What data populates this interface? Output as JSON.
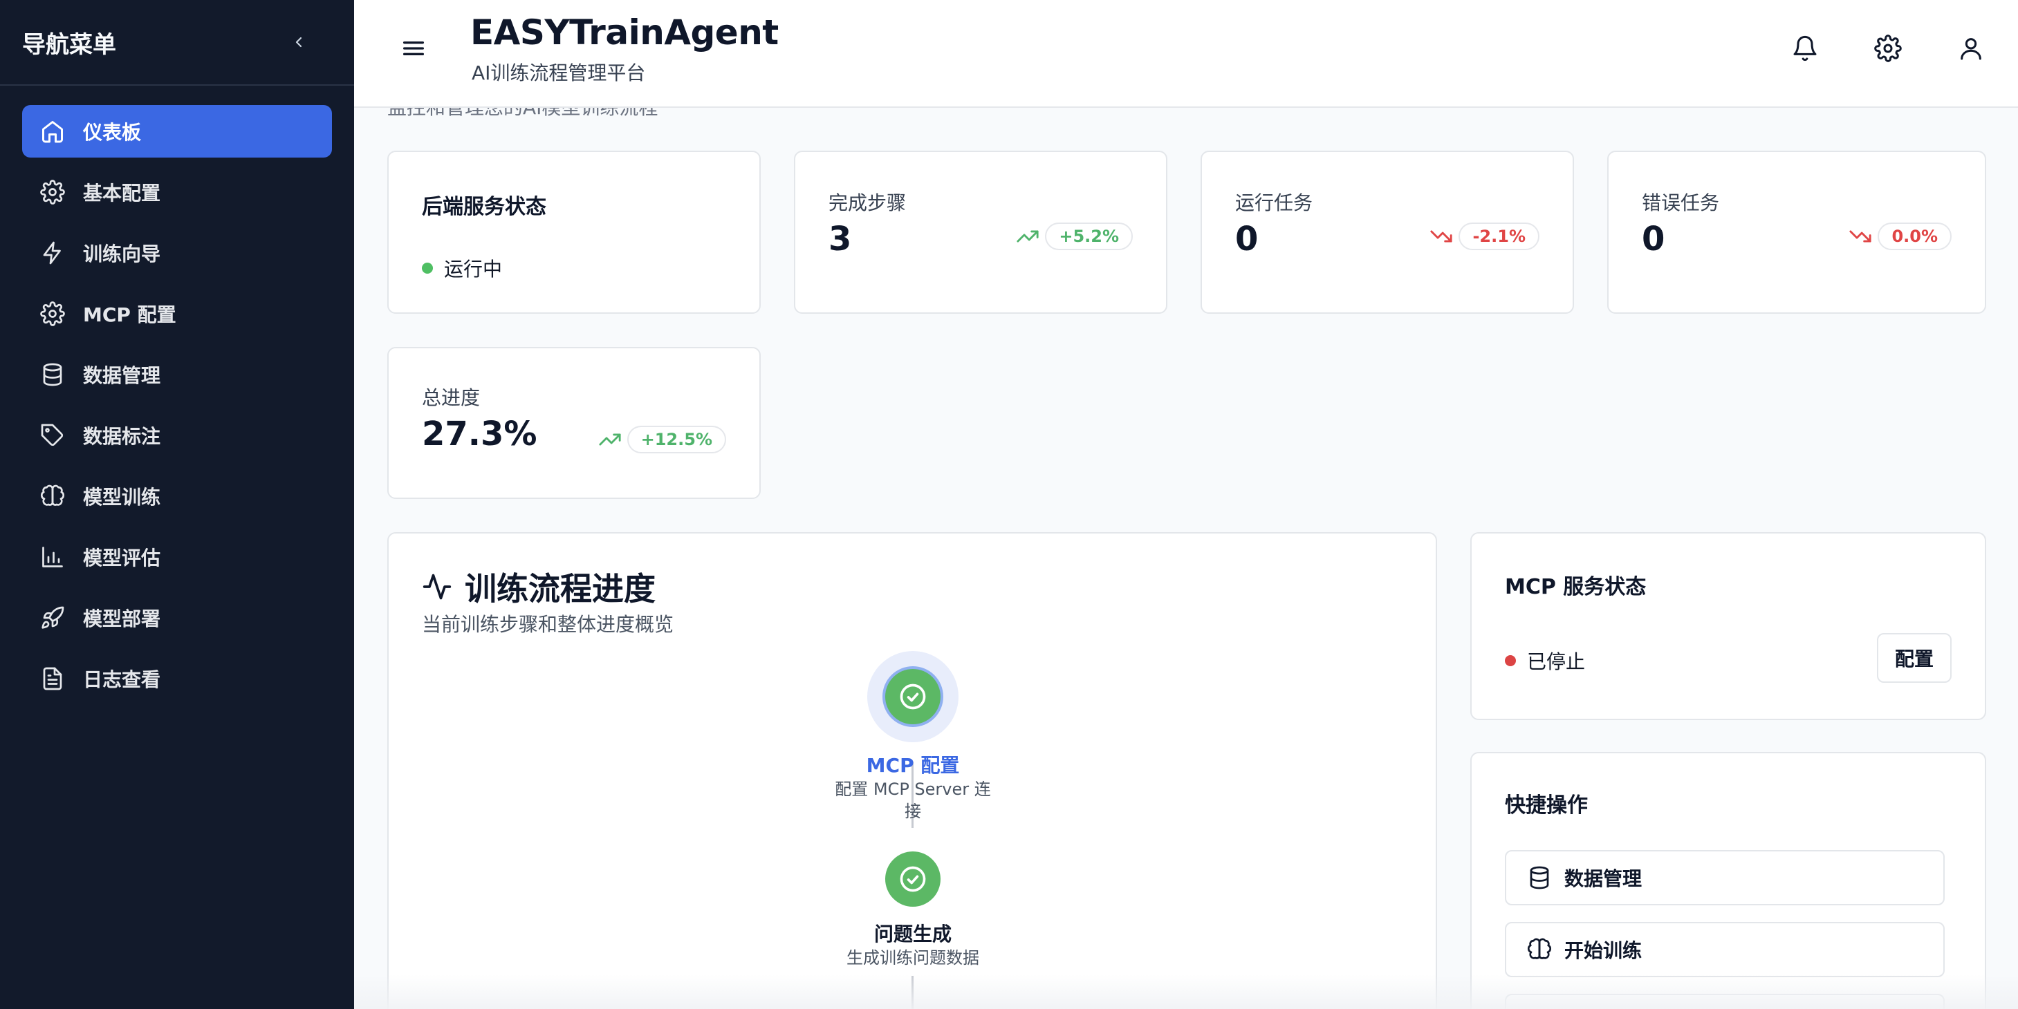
{
  "sidebar": {
    "title": "导航菜单",
    "items": [
      {
        "label": "仪表板",
        "icon": "home-icon",
        "active": true
      },
      {
        "label": "基本配置",
        "icon": "gear-icon"
      },
      {
        "label": "训练向导",
        "icon": "lightning-icon"
      },
      {
        "label": "MCP 配置",
        "icon": "gear-icon"
      },
      {
        "label": "数据管理",
        "icon": "database-icon"
      },
      {
        "label": "数据标注",
        "icon": "tag-icon"
      },
      {
        "label": "模型训练",
        "icon": "brain-icon"
      },
      {
        "label": "模型评估",
        "icon": "bar-chart-icon"
      },
      {
        "label": "模型部署",
        "icon": "rocket-icon"
      },
      {
        "label": "日志查看",
        "icon": "file-text-icon"
      }
    ]
  },
  "header": {
    "title": "EASYTrainAgent",
    "subtitle": "AI训练流程管理平台"
  },
  "main": {
    "breadcrumb": "监控和管理您的AI模型训练流程"
  },
  "backend": {
    "title": "后端服务状态",
    "status": "运行中",
    "status_color": "#4fbf63"
  },
  "stats": [
    {
      "title": "完成步骤",
      "value": "3",
      "trend": "+5.2%",
      "direction": "up"
    },
    {
      "title": "运行任务",
      "value": "0",
      "trend": "-2.1%",
      "direction": "down"
    },
    {
      "title": "错误任务",
      "value": "0",
      "trend": "0.0%",
      "direction": "down"
    },
    {
      "title": "总进度",
      "value": "27.3%",
      "trend": "+12.5%",
      "direction": "up"
    }
  ],
  "flow": {
    "title": "训练流程进度",
    "subtitle": "当前训练步骤和整体进度概览",
    "steps": [
      {
        "name": "MCP 配置",
        "desc_line1": "配置 MCP Server 连",
        "desc_line2": "接",
        "state": "current"
      },
      {
        "name": "问题生成",
        "desc_line1": "生成训练问题数据",
        "desc_line2": "",
        "state": "done"
      }
    ]
  },
  "mcp": {
    "title": "MCP 服务状态",
    "status": "已停止",
    "status_color": "#dc4444",
    "button": "配置"
  },
  "quick_actions": {
    "title": "快捷操作",
    "items": [
      {
        "label": "数据管理",
        "icon": "database-icon"
      },
      {
        "label": "开始训练",
        "icon": "brain-icon"
      }
    ]
  },
  "colors": {
    "accent": "#3b68e3",
    "sidebar_bg": "#121a2b",
    "success": "#5cb865",
    "danger": "#e04545"
  }
}
